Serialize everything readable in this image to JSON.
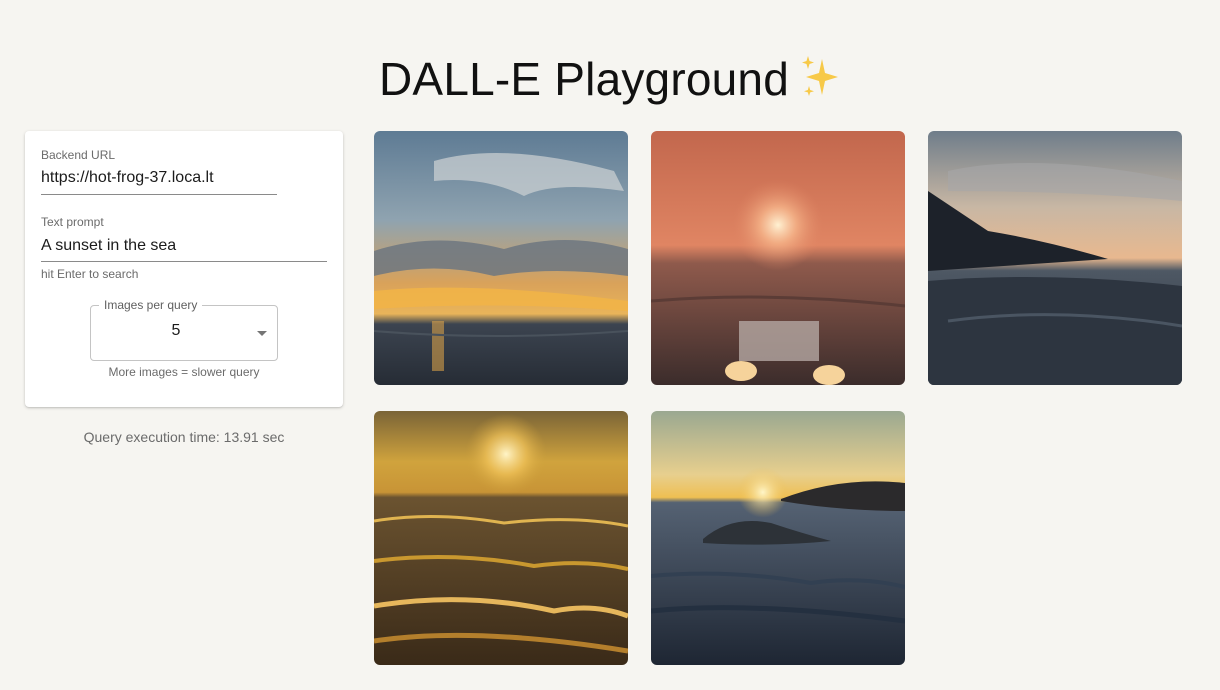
{
  "header": {
    "title": "DALL-E Playground",
    "sparkle_icon": "sparkles-icon"
  },
  "form": {
    "backend_url": {
      "label": "Backend URL",
      "value": "https://hot-frog-37.loca.lt"
    },
    "text_prompt": {
      "label": "Text prompt",
      "value": "A sunset in the sea",
      "helper": "hit Enter to search"
    },
    "images_per_query": {
      "label": "Images per query",
      "value": "5",
      "helper": "More images = slower query"
    }
  },
  "status": {
    "execution_time": "Query execution time: 13.91 sec"
  },
  "results": {
    "count": 5,
    "images": [
      {
        "icon": "generated-image-sunset-clouds"
      },
      {
        "icon": "generated-image-pink-sunset"
      },
      {
        "icon": "generated-image-coastal-dusk"
      },
      {
        "icon": "generated-image-golden-waves"
      },
      {
        "icon": "generated-image-rock-islands"
      }
    ]
  },
  "colors": {
    "background": "#f6f5f1",
    "card": "#ffffff",
    "muted_text": "#6b6b6b",
    "sparkle_yellow": "#f7c948"
  }
}
